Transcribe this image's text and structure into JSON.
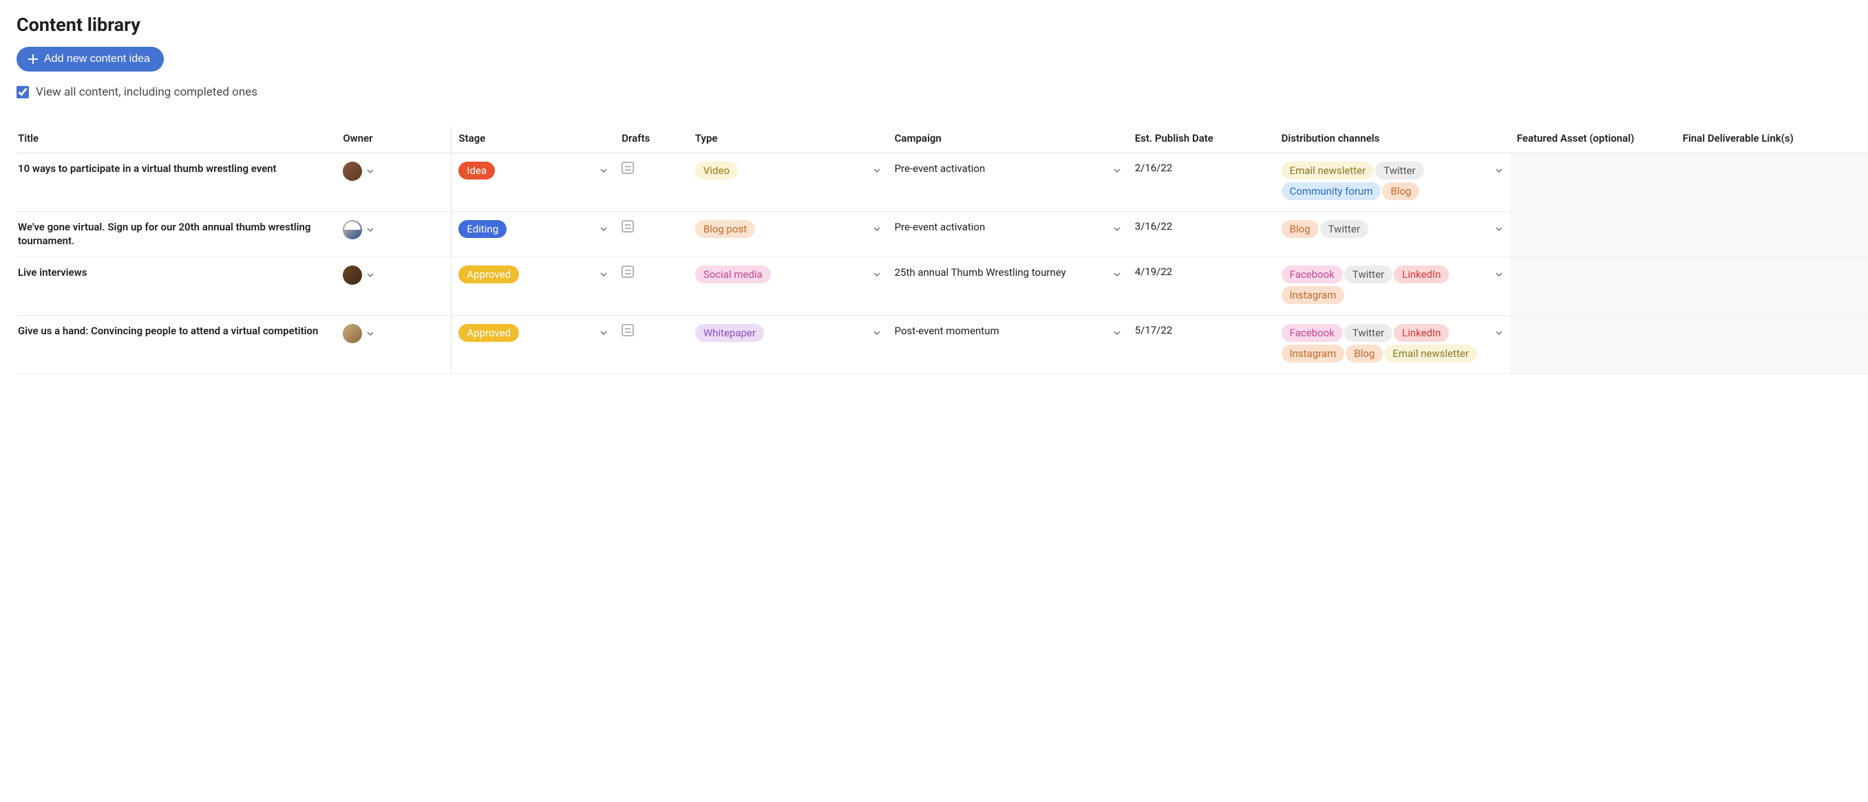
{
  "page_title": "Content library",
  "add_button_label": "Add new content idea",
  "checkbox_label": "View all content, including completed ones",
  "columns": {
    "title": "Title",
    "owner": "Owner",
    "stage": "Stage",
    "drafts": "Drafts",
    "type": "Type",
    "campaign": "Campaign",
    "date": "Est. Publish Date",
    "dist": "Distribution channels",
    "featured": "Featured Asset (optional)",
    "final": "Final Deliverable Link(s)"
  },
  "rows": [
    {
      "title": "10 ways to participate in a virtual thumb wrestling event",
      "stage": {
        "label": "Idea",
        "class": "pill-idea"
      },
      "type": {
        "label": "Video",
        "class": "pill-video"
      },
      "campaign": "Pre-event activation",
      "date": "2/16/22",
      "channels": [
        {
          "label": "Email newsletter",
          "class": "pill-email"
        },
        {
          "label": "Twitter",
          "class": "pill-twitter"
        },
        {
          "label": "Community forum",
          "class": "pill-community"
        },
        {
          "label": "Blog",
          "class": "pill-blog"
        }
      ]
    },
    {
      "title": "We've gone virtual. Sign up for our 20th annual thumb wrestling tournament.",
      "stage": {
        "label": "Editing",
        "class": "pill-editing"
      },
      "type": {
        "label": "Blog post",
        "class": "pill-blogpost"
      },
      "campaign": "Pre-event activation",
      "date": "3/16/22",
      "channels": [
        {
          "label": "Blog",
          "class": "pill-blog"
        },
        {
          "label": "Twitter",
          "class": "pill-twitter"
        }
      ]
    },
    {
      "title": "Live interviews",
      "stage": {
        "label": "Approved",
        "class": "pill-approved"
      },
      "type": {
        "label": "Social media",
        "class": "pill-social"
      },
      "campaign": "25th annual Thumb Wrestling tourney",
      "date": "4/19/22",
      "channels": [
        {
          "label": "Facebook",
          "class": "pill-facebook"
        },
        {
          "label": "Twitter",
          "class": "pill-twitter"
        },
        {
          "label": "LinkedIn",
          "class": "pill-linkedin"
        },
        {
          "label": "Instagram",
          "class": "pill-instagram"
        }
      ]
    },
    {
      "title": "Give us a hand: Convincing people to attend a virtual competition",
      "stage": {
        "label": "Approved",
        "class": "pill-approved"
      },
      "type": {
        "label": "Whitepaper",
        "class": "pill-whitepaper"
      },
      "campaign": "Post-event momentum",
      "date": "5/17/22",
      "channels": [
        {
          "label": "Facebook",
          "class": "pill-facebook"
        },
        {
          "label": "Twitter",
          "class": "pill-twitter"
        },
        {
          "label": "LinkedIn",
          "class": "pill-linkedin"
        },
        {
          "label": "Instagram",
          "class": "pill-instagram"
        },
        {
          "label": "Blog",
          "class": "pill-blog"
        },
        {
          "label": "Email newsletter",
          "class": "pill-email"
        }
      ]
    }
  ]
}
